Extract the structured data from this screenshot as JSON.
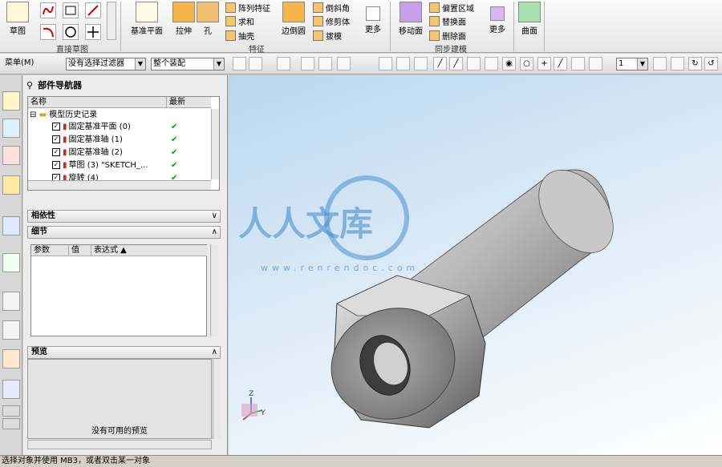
{
  "ribbon": {
    "sketch": {
      "label": "草图",
      "group_label": "直接草图"
    },
    "feature_group_label": "特征",
    "sync_group_label": "同步建模",
    "datum_plane": "基准平面",
    "extrude": "拉伸",
    "hole": "孔",
    "pattern": "阵列特征",
    "unite": "求和",
    "shell": "抽壳",
    "edge_blend": "边倒圆",
    "chamfer": "倒斜角",
    "trim_body": "修剪体",
    "draft": "拔模",
    "more1": "更多",
    "move_face": "移动面",
    "offset_region": "偏置区域",
    "replace_face": "替换面",
    "delete_face": "删除面",
    "more2": "更多",
    "surface": "曲面"
  },
  "toolbar2": {
    "menu": "菜单(M)",
    "selection_filter": "没有选择过滤器",
    "scope": "整个装配",
    "layer_value": "1"
  },
  "navigator": {
    "title": "部件导航器",
    "col_name": "名称",
    "col_latest": "最新",
    "root": "模型历史记录",
    "rows": [
      {
        "label": "固定基准平面 (0)",
        "latest": "✔"
      },
      {
        "label": "固定基准轴 (1)",
        "latest": "✔"
      },
      {
        "label": "固定基准轴 (2)",
        "latest": "✔"
      },
      {
        "label": "草图 (3) \"SKETCH_...",
        "latest": "✔"
      },
      {
        "label": "旋转 (4)",
        "latest": "✔"
      }
    ],
    "dependencies": "相依性",
    "details": "细节",
    "detail_cols": {
      "param": "参数",
      "value": "值",
      "expression": "表达式 ▲"
    },
    "preview": "预览",
    "no_preview": "没有可用的预览"
  },
  "watermark": {
    "text": "人人文库",
    "url": "www.renrendoc.com"
  },
  "triad": {
    "z": "Z",
    "y": "Y"
  },
  "status_bar": "选择对象并使用 MB3，或者双击某一对象"
}
